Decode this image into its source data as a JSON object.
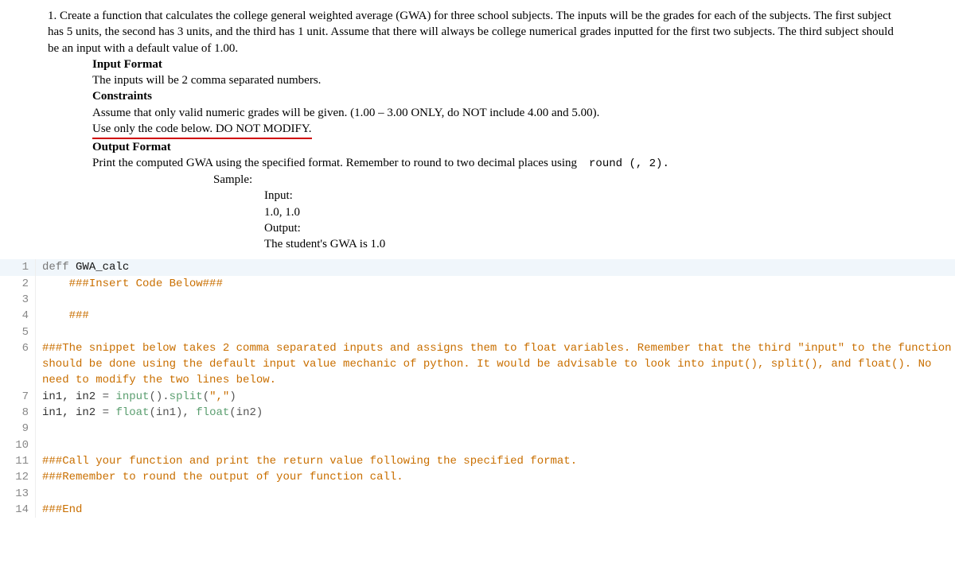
{
  "problem": {
    "main_para": "1. Create a function that calculates the college general weighted average (GWA) for three school subjects. The inputs will be the grades for each of the subjects. The first subject has 5 units, the second has 3 units, and the third has 1 unit. Assume that there will always be college numerical grades inputted for the first two subjects. The third subject should be an input with a default value of 1.00.",
    "input_format_h": "Input Format",
    "input_format_b": "The inputs will be 2 comma separated numbers.",
    "constraints_h": "Constraints",
    "constraints_b1": "Assume that only valid numeric grades will be given. (1.00 – 3.00 ONLY, do NOT include 4.00 and 5.00).",
    "constraints_b2": "Use only the code below. DO NOT MODIFY.",
    "output_format_h": "Output Format",
    "output_format_b_a": "Print the computed GWA using the specified format. Remember to round to two decimal places using",
    "output_format_b_code": "round (, 2).",
    "sample_h": "Sample:",
    "sample_input_l": "Input:",
    "sample_input_v": "1.0, 1.0",
    "sample_output_l": "Output:",
    "sample_output_v": "The student's GWA is 1.0"
  },
  "code": {
    "line1": {
      "kw": "deff",
      "fn": " GWA_calc"
    },
    "line2_indent": "    ",
    "line2": "###Insert Code Below###",
    "line4_indent": "    ",
    "line4": "###",
    "line6": "###The snippet below takes 2 comma separated inputs and assigns them to float variables. Remember that the third \"input\" to the function should be done using the default input value mechanic of python. It would be advisable to look into input(), split(), and float(). No need to modify the two lines below.",
    "line7": {
      "a": "in1, in2 ",
      "eq": "=",
      "sp": " ",
      "b1": "input",
      "p1": "().",
      "b2": "split",
      "p2": "(",
      "s": "\",\"",
      "p3": ")"
    },
    "line8": {
      "a": "in1, in2 ",
      "eq": "=",
      "sp": " ",
      "b1": "float",
      "p1": "(in1), ",
      "b2": "float",
      "p2": "(in2)"
    },
    "line11": "###Call your function and print the return value following the specified format.",
    "line12": "###Remember to round the output of your function call.",
    "line14": "###End"
  }
}
